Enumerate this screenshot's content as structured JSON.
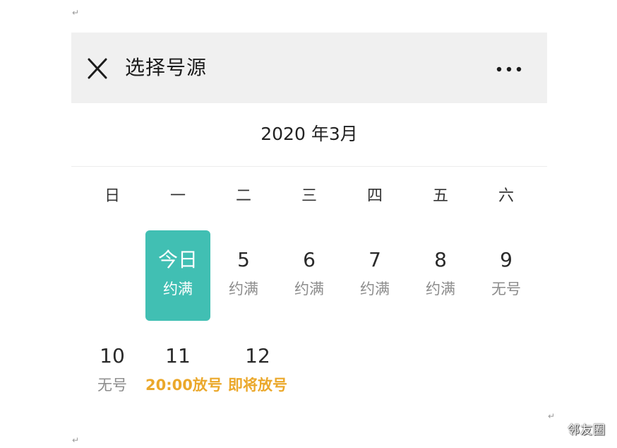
{
  "paragraph_mark": "↵",
  "header": {
    "title": "选择号源",
    "close_icon": "close-icon",
    "more_icon": "more-dots-icon"
  },
  "calendar": {
    "month_title": "2020 年3月",
    "weekdays": [
      "日",
      "一",
      "二",
      "三",
      "四",
      "五",
      "六"
    ],
    "days": [
      {
        "number": "今日",
        "status": "约满",
        "today": true
      },
      {
        "number": "5",
        "status": "约满"
      },
      {
        "number": "6",
        "status": "约满"
      },
      {
        "number": "7",
        "status": "约满"
      },
      {
        "number": "8",
        "status": "约满"
      },
      {
        "number": "9",
        "status": "无号"
      },
      {
        "number": "10",
        "status": "无号"
      },
      {
        "number": "11",
        "status": "20:00放号"
      },
      {
        "number": "12",
        "status": "即将放号"
      }
    ]
  },
  "colors": {
    "today_bg": "#41bfb3",
    "highlight": "#eba82b",
    "topbar_bg": "#f0f0f0"
  },
  "watermark": "邻友圈"
}
